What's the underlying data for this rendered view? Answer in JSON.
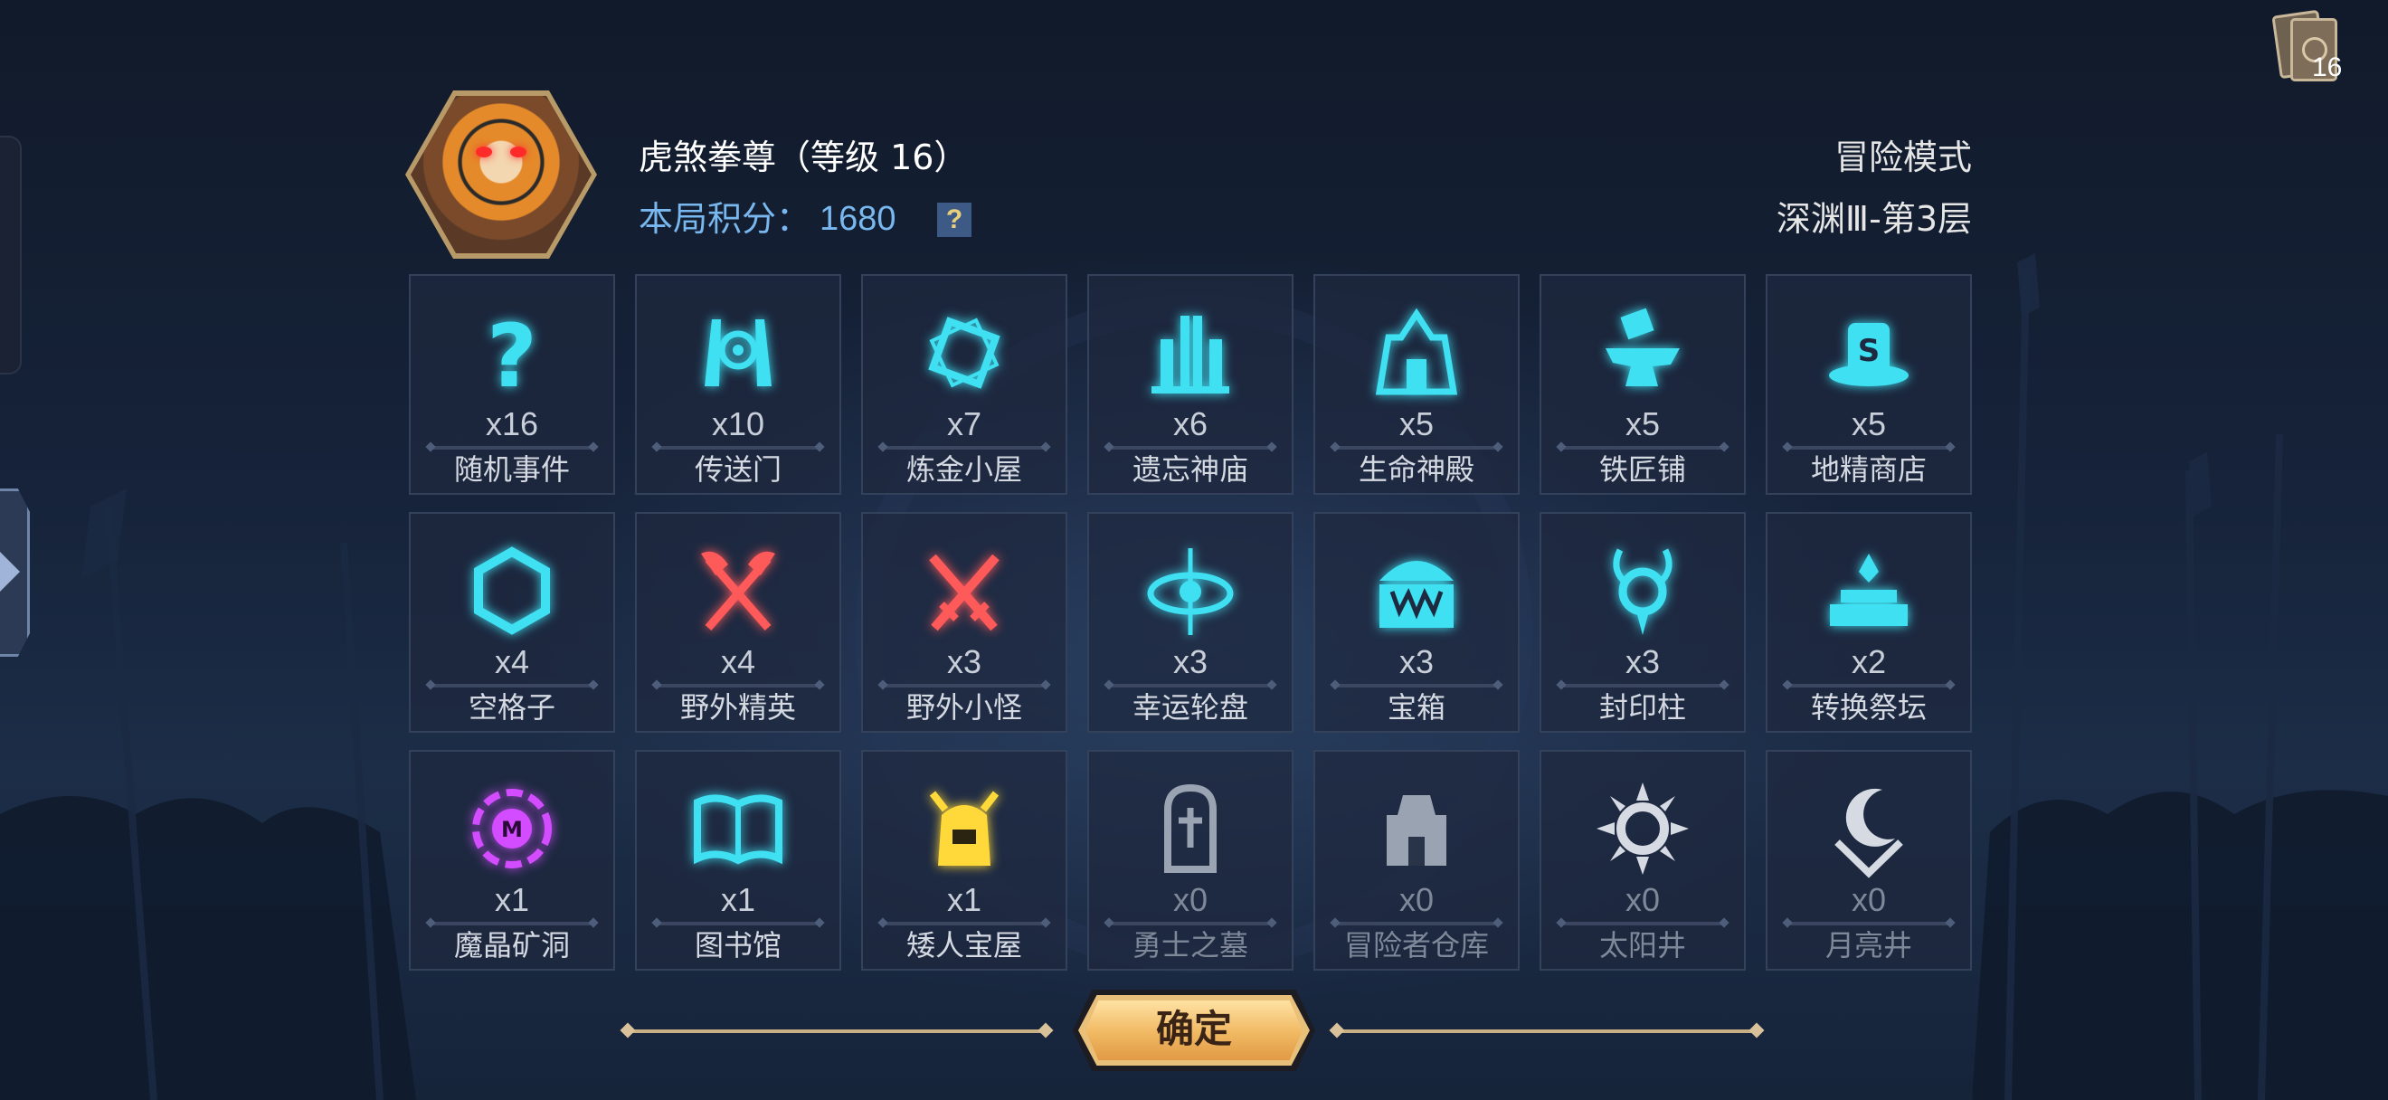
{
  "deck": {
    "count": "16"
  },
  "hero": {
    "name": "虎煞拳尊（等级 16）",
    "score_label": "本局积分：",
    "score_value": "1680",
    "help": "?"
  },
  "mode": {
    "title": "冒险模式",
    "floor": "深渊Ⅲ-第3层"
  },
  "tiles": [
    {
      "name": "随机事件",
      "count": "x16",
      "icon": "question-icon",
      "color": "#3fe0f2"
    },
    {
      "name": "传送门",
      "count": "x10",
      "icon": "portal-icon",
      "color": "#3fe0f2"
    },
    {
      "name": "炼金小屋",
      "count": "x7",
      "icon": "alchemy-icon",
      "color": "#3fe0f2"
    },
    {
      "name": "遗忘神庙",
      "count": "x6",
      "icon": "temple-icon",
      "color": "#3fe0f2"
    },
    {
      "name": "生命神殿",
      "count": "x5",
      "icon": "shrine-icon",
      "color": "#3fe0f2"
    },
    {
      "name": "铁匠铺",
      "count": "x5",
      "icon": "anvil-icon",
      "color": "#3fe0f2"
    },
    {
      "name": "地精商店",
      "count": "x5",
      "icon": "shop-icon",
      "color": "#3fe0f2"
    },
    {
      "name": "空格子",
      "count": "x4",
      "icon": "hexagon-icon",
      "color": "#3fe0f2"
    },
    {
      "name": "野外精英",
      "count": "x4",
      "icon": "crossed-axes-icon",
      "color": "#ff5a5a"
    },
    {
      "name": "野外小怪",
      "count": "x3",
      "icon": "crossed-swords-icon",
      "color": "#ff5a5a"
    },
    {
      "name": "幸运轮盘",
      "count": "x3",
      "icon": "wheel-icon",
      "color": "#3fe0f2"
    },
    {
      "name": "宝箱",
      "count": "x3",
      "icon": "chest-icon",
      "color": "#3fe0f2"
    },
    {
      "name": "封印柱",
      "count": "x3",
      "icon": "seal-pillar-icon",
      "color": "#3fe0f2"
    },
    {
      "name": "转换祭坛",
      "count": "x2",
      "icon": "altar-icon",
      "color": "#3fe0f2"
    },
    {
      "name": "魔晶矿洞",
      "count": "x1",
      "icon": "crystal-mine-icon",
      "color": "#d34cff"
    },
    {
      "name": "图书馆",
      "count": "x1",
      "icon": "book-icon",
      "color": "#3fe0f2"
    },
    {
      "name": "矮人宝屋",
      "count": "x1",
      "icon": "dwarf-helmet-icon",
      "color": "#ffd93a"
    },
    {
      "name": "勇士之墓",
      "count": "x0",
      "icon": "tomb-icon",
      "color": "#9aa3b2"
    },
    {
      "name": "冒险者仓库",
      "count": "x0",
      "icon": "warehouse-icon",
      "color": "#9aa3b2"
    },
    {
      "name": "太阳井",
      "count": "x0",
      "icon": "sun-well-icon",
      "color": "#d6dbe3"
    },
    {
      "name": "月亮井",
      "count": "x0",
      "icon": "moon-well-icon",
      "color": "#d6dbe3"
    }
  ],
  "confirm": {
    "label": "确定"
  }
}
